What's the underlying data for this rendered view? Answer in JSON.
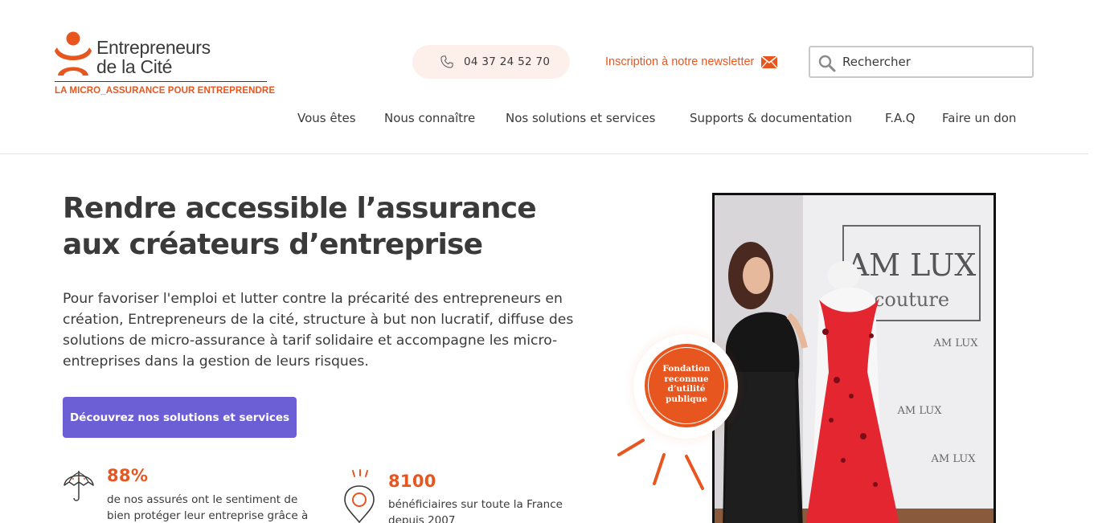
{
  "header": {
    "logo": {
      "name_line1": "Entrepreneurs",
      "name_line2": "de la Cité",
      "tagline": "LA MICRO_ASSURANCE POUR ENTREPRENDRE"
    },
    "phone": "04 37 24 52 70",
    "newsletter_label": "Inscription à notre newsletter",
    "search": {
      "placeholder": "Rechercher"
    },
    "nav": [
      "Vous êtes",
      "Nous connaître",
      "Nos solutions et services",
      "Supports & documentation",
      "F.A.Q",
      "Faire un don"
    ]
  },
  "hero": {
    "title_line1": "Rendre accessible l’assurance",
    "title_line2": "aux créateurs d’entreprise",
    "text": "Pour favoriser l'emploi et lutter contre la précarité des entrepreneurs en création, Entrepreneurs de la cité, structure à but non lucratif, diffuse des solutions de micro-assurance à tarif solidaire et accompagne les micro-entreprises dans la gestion de leurs risques.",
    "cta_label": "Découvrez nos solutions et services",
    "badge_lines": [
      "Fondation",
      "reconnue",
      "d’utilité",
      "publique"
    ],
    "photo_sign": [
      "AM LUX",
      "couture"
    ]
  },
  "stats": [
    {
      "value": "88%",
      "text_line1": "de nos assurés ont le sentiment de",
      "text_line2": "bien protéger leur entreprise grâce à",
      "icon": "umbrella-icon"
    },
    {
      "value": "8100",
      "text_line1": "bénéficiaires sur toute la France",
      "text_line2": "depuis 2007",
      "icon": "location-pin-icon"
    }
  ],
  "colors": {
    "accent": "#e8561f",
    "cta": "#6c5fd5",
    "text": "#3a3a3a",
    "phone_bg": "#fdf0ea"
  }
}
